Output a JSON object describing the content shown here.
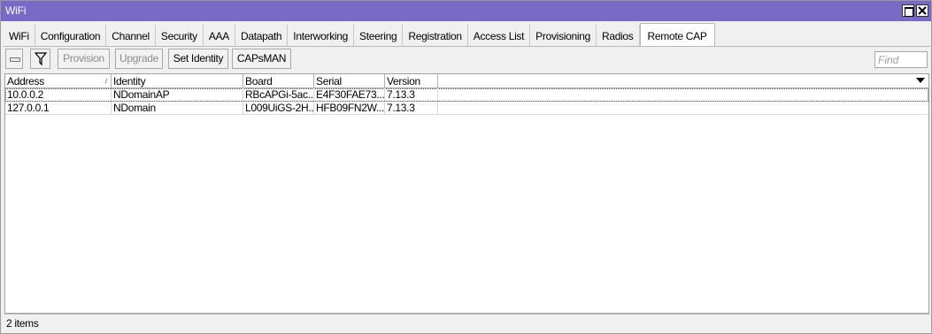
{
  "window": {
    "title": "WiFi"
  },
  "tabs": [
    {
      "label": "WiFi"
    },
    {
      "label": "Configuration"
    },
    {
      "label": "Channel"
    },
    {
      "label": "Security"
    },
    {
      "label": "AAA"
    },
    {
      "label": "Datapath"
    },
    {
      "label": "Interworking"
    },
    {
      "label": "Steering"
    },
    {
      "label": "Registration"
    },
    {
      "label": "Access List"
    },
    {
      "label": "Provisioning"
    },
    {
      "label": "Radios"
    },
    {
      "label": "Remote CAP",
      "active": true
    }
  ],
  "toolbar": {
    "remove_icon": "minus-icon",
    "filter_icon": "filter-icon",
    "provision_label": "Provision",
    "upgrade_label": "Upgrade",
    "set_identity_label": "Set Identity",
    "capsman_label": "CAPsMAN",
    "find_placeholder": "Find"
  },
  "table": {
    "columns": [
      "Address",
      "Identity",
      "Board",
      "Serial",
      "Version"
    ],
    "sort_column": "Address",
    "rows": [
      {
        "address": "10.0.0.2",
        "identity": "NDomainAP",
        "board": "RBcAPGi-5ac...",
        "serial": "E4F30FAE73...",
        "version": "7.13.3"
      },
      {
        "address": "127.0.0.1",
        "identity": "NDomain",
        "board": "L009UiGS-2H...",
        "serial": "HFB09FN2W...",
        "version": "7.13.3"
      }
    ]
  },
  "status": {
    "text": "2 items"
  },
  "colors": {
    "titlebar": "#7a6ac8",
    "window_bg": "#f0f0f0"
  }
}
